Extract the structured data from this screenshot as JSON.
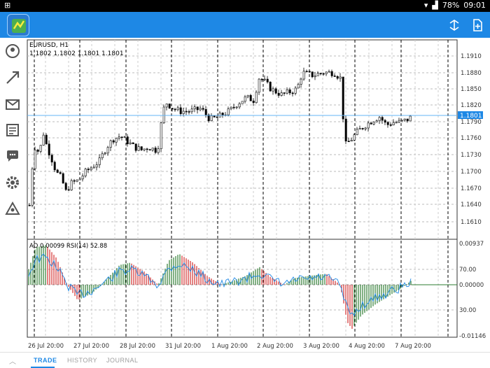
{
  "status_bar": {
    "battery": "78%",
    "time": "09:01"
  },
  "chart": {
    "symbol": "EURUSD, H1",
    "ohlc_text": "1.1802 1.1802 1.1801 1.1801",
    "current_price": "1.1801",
    "price_labels": [
      "1.1910",
      "1.1880",
      "1.1850",
      "1.1820",
      "1.1790",
      "1.1760",
      "1.1730",
      "1.1700",
      "1.1670",
      "1.1640",
      "1.1610"
    ],
    "indicator_title": "AO 0.00099 RSI(14) 52.88",
    "indicator_labels": [
      "0.00937",
      "70.00",
      "0.00000",
      "30.00",
      "-0.01146"
    ],
    "date_labels": [
      "26 Jul 20:00",
      "27 Jul 20:00",
      "28 Jul 20:00",
      "31 Jul 20:00",
      "1 Aug 20:00",
      "2 Aug 20:00",
      "3 Aug 20:00",
      "4 Aug 20:00",
      "7 Aug 20:00"
    ],
    "colors": {
      "up": "#2e7d32",
      "down": "#d32f2f",
      "rsi": "#1e88e5",
      "price_line": "#64b5f6"
    }
  },
  "tabs": [
    "TRADE",
    "HISTORY",
    "JOURNAL"
  ]
}
